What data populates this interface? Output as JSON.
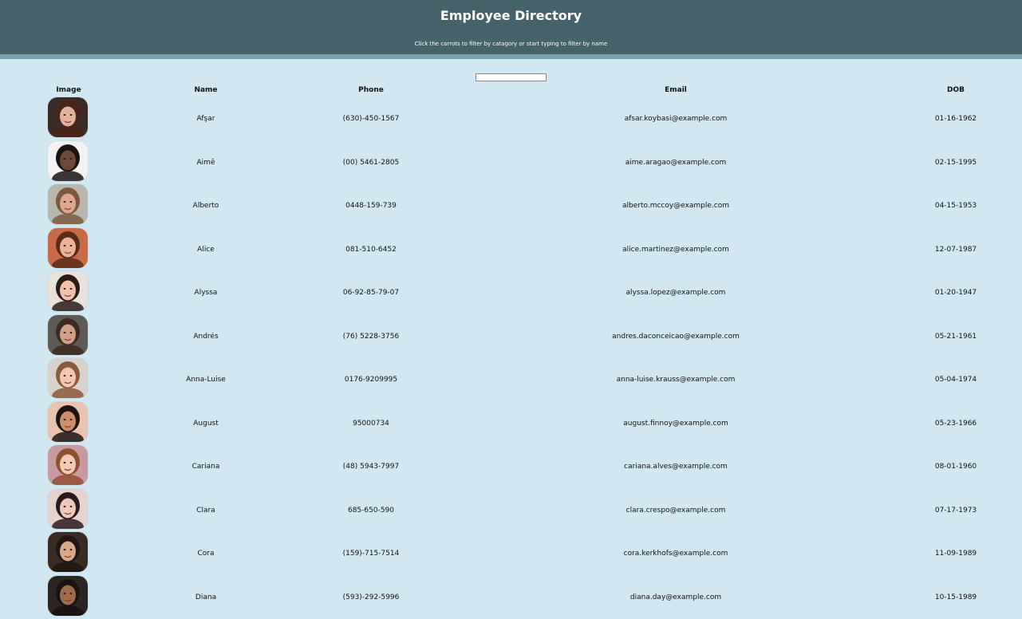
{
  "header": {
    "title": "Employee Directory",
    "subtitle": "Click the carrots to filter by catagory or start typing to filter by name"
  },
  "search": {
    "value": "",
    "placeholder": ""
  },
  "columns": [
    "Image",
    "Name",
    "Phone",
    "Email",
    "DOB"
  ],
  "employees": [
    {
      "name": "Afşar",
      "phone": "(630)-450-1567",
      "email": "afsar.koybasi@example.com",
      "dob": "01-16-1962",
      "bg": "#3a2a28",
      "skin": "#e2b39c",
      "hair": "#4a2419"
    },
    {
      "name": "Aimê",
      "phone": "(00) 5461-2805",
      "email": "aime.aragao@example.com",
      "dob": "02-15-1995",
      "bg": "#f2f2f2",
      "skin": "#6b4a3a",
      "hair": "#1a1411"
    },
    {
      "name": "Alberto",
      "phone": "0448-159-739",
      "email": "alberto.mccoy@example.com",
      "dob": "04-15-1953",
      "bg": "#b9b6ae",
      "skin": "#dca98c",
      "hair": "#7a5a3e"
    },
    {
      "name": "Alice",
      "phone": "081-510-6452",
      "email": "alice.martinez@example.com",
      "dob": "12-07-1987",
      "bg": "#c86a48",
      "skin": "#e9b596",
      "hair": "#5b2b1a"
    },
    {
      "name": "Alyssa",
      "phone": "06-92-85-79-07",
      "email": "alyssa.lopez@example.com",
      "dob": "01-20-1947",
      "bg": "#e8e1dc",
      "skin": "#f1c2aa",
      "hair": "#2a1b17"
    },
    {
      "name": "Andrés",
      "phone": "(76) 5228-3756",
      "email": "andres.daconceicao@example.com",
      "dob": "05-21-1961",
      "bg": "#5e5a55",
      "skin": "#cfa08a",
      "hair": "#3b2b22"
    },
    {
      "name": "Anna-Luise",
      "phone": "0176-9209995",
      "email": "anna-luise.krauss@example.com",
      "dob": "05-04-1974",
      "bg": "#d8d2cc",
      "skin": "#efc8b4",
      "hair": "#8a5a3a"
    },
    {
      "name": "August",
      "phone": "95000734",
      "email": "august.finnoy@example.com",
      "dob": "05-23-1966",
      "bg": "#e7c3b0",
      "skin": "#c98e6c",
      "hair": "#1d1412"
    },
    {
      "name": "Cariana",
      "phone": "(48) 5943-7997",
      "email": "cariana.alves@example.com",
      "dob": "08-01-1960",
      "bg": "#c79aa0",
      "skin": "#f2c9b3",
      "hair": "#8f4f2f"
    },
    {
      "name": "Clara",
      "phone": "685-650-590",
      "email": "clara.crespo@example.com",
      "dob": "07-17-1973",
      "bg": "#e6d2cf",
      "skin": "#f0c8bb",
      "hair": "#2a1a1c"
    },
    {
      "name": "Cora",
      "phone": "(159)-715-7514",
      "email": "cora.kerkhofs@example.com",
      "dob": "11-09-1989",
      "bg": "#3a2c24",
      "skin": "#d7a88a",
      "hair": "#1f1512"
    },
    {
      "name": "Diana",
      "phone": "(593)-292-5996",
      "email": "diana.day@example.com",
      "dob": "10-15-1989",
      "bg": "#2b2523",
      "skin": "#a06a4c",
      "hair": "#1a1210"
    }
  ]
}
